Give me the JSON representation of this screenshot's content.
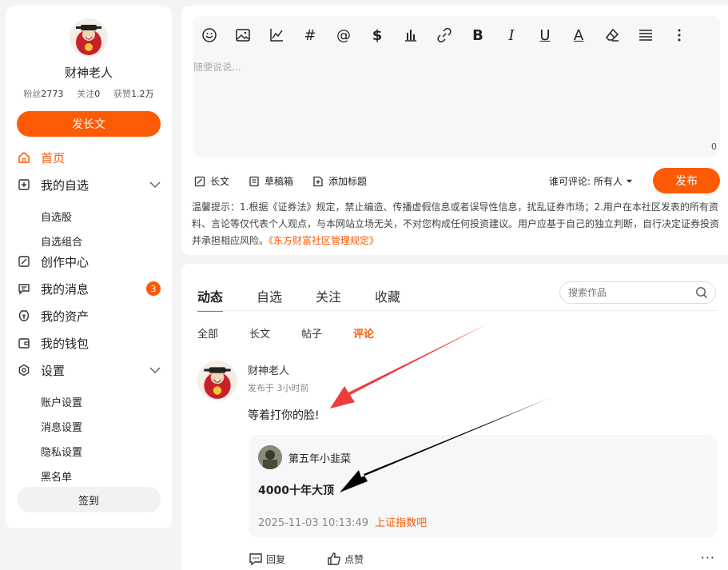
{
  "profile": {
    "name": "财神老人",
    "fans_label": "粉丝",
    "fans": "2773",
    "follow_label": "关注",
    "follow": "0",
    "likes_label": "获赞",
    "likes": "1.2万",
    "longpost_button": "发长文"
  },
  "nav": {
    "home": "首页",
    "watchlist": "我的自选",
    "watch_stocks": "自选股",
    "watch_combos": "自选组合",
    "creator": "创作中心",
    "messages": "我的消息",
    "messages_badge": "3",
    "assets": "我的资产",
    "wallet": "我的钱包",
    "settings": "设置",
    "account_settings": "账户设置",
    "message_settings": "消息设置",
    "privacy_settings": "隐私设置",
    "blacklist": "黑名单",
    "signin": "签到"
  },
  "editor": {
    "placeholder": "随便说说...",
    "counter": "0",
    "longpost": "长文",
    "drafts": "草稿箱",
    "add_title": "添加标题",
    "comment_perm_label": "谁可评论:",
    "comment_perm_value": "所有人",
    "publish": "发布",
    "notice": "温馨提示：1.根据《证券法》规定，禁止编造、传播虚假信息或者误导性信息，扰乱证券市场；2.用户在本社区发表的所有资料、言论等仅代表个人观点，与本网站立场无关，不对您构成任何投资建议。用户应基于自己的独立判断，自行决定证券投资并承担相应风险。",
    "notice_link": "《东方财富社区管理规定》",
    "toolbar_icons": [
      "emoji-icon",
      "image-icon",
      "chart-icon",
      "hashtag-icon",
      "at-icon",
      "dollar-icon",
      "bar-chart-icon",
      "link-icon",
      "bold-icon",
      "italic-icon",
      "underline-icon",
      "font-color-icon",
      "eraser-icon",
      "align-icon",
      "more-vertical-icon"
    ]
  },
  "feed": {
    "tabs": [
      "动态",
      "自选",
      "关注",
      "收藏"
    ],
    "search_placeholder": "搜索作品",
    "subtabs": [
      "全部",
      "长文",
      "帖子",
      "评论"
    ],
    "post": {
      "author": "财神老人",
      "time": "发布于 3小时前",
      "text": "等着打你的脸!",
      "quote_author": "第五年小韭菜",
      "quote_text": "4000十年大顶",
      "quote_time": "2025-11-03 10:13:49",
      "quote_bar": "上证指数吧",
      "reply": "回复",
      "like": "点赞",
      "more": "···"
    }
  },
  "colors": {
    "accent": "#fd5a05",
    "arrow_red": "#ee3b3b",
    "arrow_black": "#000000"
  }
}
